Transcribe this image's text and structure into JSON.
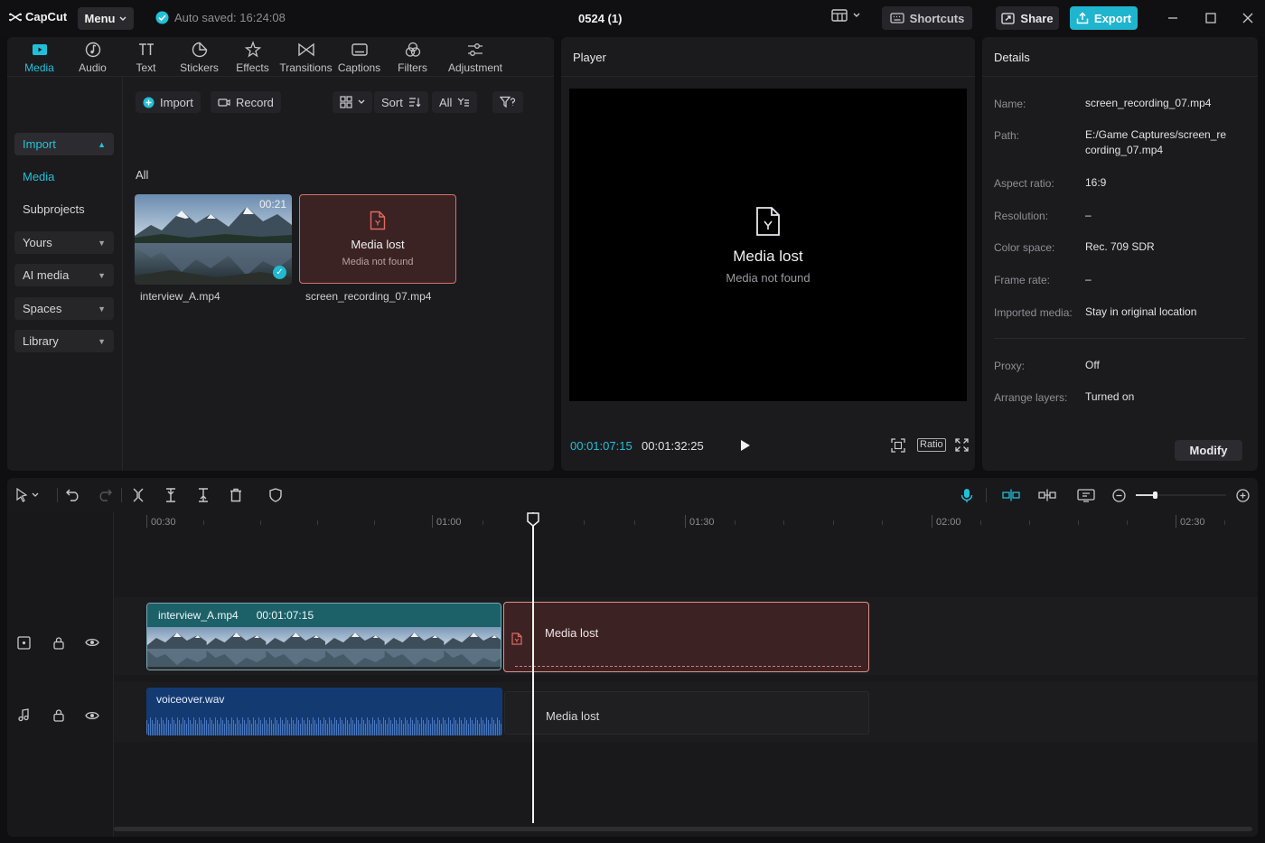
{
  "app": {
    "name": "CapCut",
    "menu_label": "Menu",
    "autosave": "Auto saved: 16:24:08",
    "project_title": "0524 (1)",
    "shortcuts_label": "Shortcuts",
    "share_label": "Share",
    "export_label": "Export"
  },
  "toolbar": {
    "tabs": [
      {
        "label": "Media",
        "icon": "media-icon",
        "active": true
      },
      {
        "label": "Audio",
        "icon": "audio-icon"
      },
      {
        "label": "Text",
        "icon": "text-icon"
      },
      {
        "label": "Stickers",
        "icon": "stickers-icon"
      },
      {
        "label": "Effects",
        "icon": "effects-icon"
      },
      {
        "label": "Transitions",
        "icon": "transitions-icon"
      },
      {
        "label": "Captions",
        "icon": "captions-icon"
      },
      {
        "label": "Filters",
        "icon": "filters-icon"
      },
      {
        "label": "Adjustment",
        "icon": "adjustment-icon"
      }
    ]
  },
  "sidebar": {
    "items": [
      {
        "label": "Import"
      },
      {
        "label": "Media"
      },
      {
        "label": "Subprojects"
      },
      {
        "label": "Yours"
      },
      {
        "label": "AI media"
      },
      {
        "label": "Spaces"
      },
      {
        "label": "Library"
      }
    ]
  },
  "media": {
    "import_label": "Import",
    "record_label": "Record",
    "sort_label": "Sort",
    "filter_label": "All",
    "section_label": "All",
    "items": [
      {
        "name": "interview_A.mp4",
        "duration": "00:21",
        "status": "ok"
      },
      {
        "name": "screen_recording_07.mp4",
        "status": "lost",
        "lost_title": "Media lost",
        "lost_sub": "Media not found"
      }
    ]
  },
  "player": {
    "title": "Player",
    "lost_title": "Media lost",
    "lost_sub": "Media not found",
    "current_time": "00:01:07:15",
    "total_time": "00:01:32:25",
    "ratio_label": "Ratio"
  },
  "details": {
    "title": "Details",
    "rows": [
      {
        "label": "Name:",
        "value": "screen_recording_07.mp4"
      },
      {
        "label": "Path:",
        "value": "E:/Game Captures/screen_recording_07.mp4"
      },
      {
        "label": "Aspect ratio:",
        "value": "16:9"
      },
      {
        "label": "Resolution:",
        "value": "–"
      },
      {
        "label": "Color space:",
        "value": "Rec. 709 SDR"
      },
      {
        "label": "Frame rate:",
        "value": "–"
      },
      {
        "label": "Imported media:",
        "value": "Stay in original location"
      },
      {
        "label": "Proxy:",
        "value": "Off"
      },
      {
        "label": "Arrange layers:",
        "value": "Turned on"
      }
    ],
    "modify_label": "Modify"
  },
  "timeline": {
    "ruler": [
      "00:30",
      "01:00",
      "01:30",
      "02:00",
      "02:30"
    ],
    "zoom_level": 0.05,
    "video_clip": {
      "name": "interview_A.mp4",
      "duration": "00:01:07:15"
    },
    "lost_video_label": "Media lost",
    "audio_clip": {
      "name": "voiceover.wav"
    },
    "lost_audio_label": "Media lost"
  },
  "colors": {
    "accent": "#22c0d8",
    "export": "#1fb5cf",
    "lost_border": "#d2726e",
    "lost_fill": "#3b2223",
    "audio_clip": "#143a72",
    "video_clip_header": "#1c6068"
  }
}
